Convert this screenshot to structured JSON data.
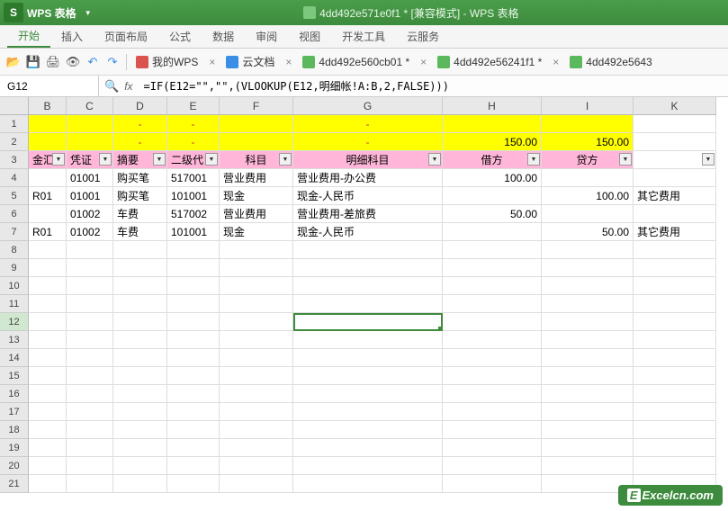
{
  "app": {
    "logo": "S",
    "name": "WPS 表格",
    "doc_title": "4dd492e571e0f1 * [兼容模式] - WPS 表格"
  },
  "menu": {
    "items": [
      "开始",
      "插入",
      "页面布局",
      "公式",
      "数据",
      "审阅",
      "视图",
      "开发工具",
      "云服务"
    ],
    "active_index": 0
  },
  "toolbar": {
    "wps_label": "我的WPS",
    "cloud_label": "云文档",
    "docs": [
      "4dd492e560cb01 *",
      "4dd492e56241f1 *",
      "4dd492e5643"
    ]
  },
  "formula": {
    "cell_ref": "G12",
    "fx": "fx",
    "value": "=IF(E12=\"\",\"\",(VLOOKUP(E12,明细帐!A:B,2,FALSE)))"
  },
  "columns": [
    "B",
    "C",
    "D",
    "E",
    "F",
    "G",
    "H",
    "I",
    "K"
  ],
  "row1": {
    "h": "150.00",
    "i": "150.00"
  },
  "headers": {
    "b": "金汇",
    "c": "凭证",
    "d": "摘要",
    "e": "二级代",
    "f": "科目",
    "g": "明细科目",
    "h": "借方",
    "i": "贷方"
  },
  "data_rows": [
    {
      "b": "",
      "c": "01001",
      "d": "购买笔",
      "e": "517001",
      "f": "营业费用",
      "g": "营业费用-办公费",
      "h": "100.00",
      "i": "",
      "k": ""
    },
    {
      "b": "R01",
      "c": "01001",
      "d": "购买笔",
      "e": "101001",
      "f": "现金",
      "g": "现金-人民币",
      "h": "",
      "i": "100.00",
      "k": "其它费用"
    },
    {
      "b": "",
      "c": "01002",
      "d": "车费",
      "e": "517002",
      "f": "营业费用",
      "g": "营业费用-差旅费",
      "h": "50.00",
      "i": "",
      "k": ""
    },
    {
      "b": "R01",
      "c": "01002",
      "d": "车费",
      "e": "101001",
      "f": "现金",
      "g": "现金-人民币",
      "h": "",
      "i": "50.00",
      "k": "其它费用"
    }
  ],
  "dash": "-",
  "watermark": "Excelcn.com",
  "active_row": 12
}
